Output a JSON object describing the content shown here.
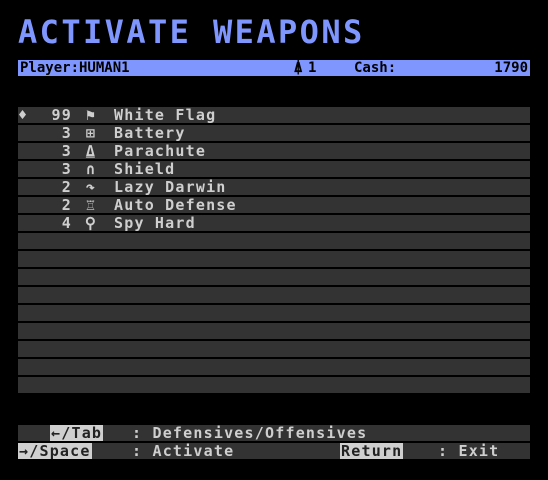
{
  "title": "ACTIVATE WEAPONS",
  "status": {
    "player": "Player:HUMAN1",
    "tank_icon": "tank-icon",
    "tank_number": "1",
    "cash_label": "Cash:",
    "cash_value": "1790"
  },
  "items": [
    {
      "selected": true,
      "marker": "♦",
      "qty": "99",
      "icon": "white-flag-icon",
      "glyph": "⚑",
      "name": "White Flag"
    },
    {
      "selected": false,
      "marker": "",
      "qty": "3",
      "icon": "battery-icon",
      "glyph": "⊞",
      "name": "Battery"
    },
    {
      "selected": false,
      "marker": "",
      "qty": "3",
      "icon": "parachute-icon",
      "glyph": "⍙",
      "name": "Parachute"
    },
    {
      "selected": false,
      "marker": "",
      "qty": "3",
      "icon": "shield-icon",
      "glyph": "∩",
      "name": "Shield"
    },
    {
      "selected": false,
      "marker": "",
      "qty": "2",
      "icon": "lazy-darwin-icon",
      "glyph": "↷",
      "name": "Lazy Darwin"
    },
    {
      "selected": false,
      "marker": "",
      "qty": "2",
      "icon": "auto-defense-icon",
      "glyph": "♖",
      "name": "Auto Defense"
    },
    {
      "selected": false,
      "marker": "",
      "qty": "4",
      "icon": "spy-hard-icon",
      "glyph": "⚲",
      "name": "Spy Hard"
    }
  ],
  "help": {
    "line1_key": "←/Tab",
    "line1_text": ": Defensives/Offensives",
    "line2_key": "→/Space",
    "line2_text": ": Activate",
    "line2_key2": "Return",
    "line2_text2": ": Exit"
  }
}
